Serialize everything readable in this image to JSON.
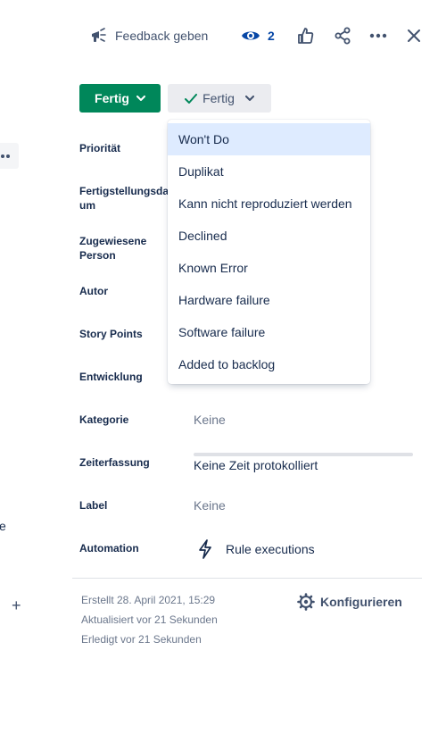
{
  "header": {
    "feedback_label": "Feedback geben",
    "watch_count": "2"
  },
  "status": {
    "current_label": "Fertig",
    "resolution_label": "Fertig",
    "status_color": "#00875a"
  },
  "resolution_menu": {
    "options": [
      "Won't Do",
      "Duplikat",
      "Kann nicht reproduziert werden",
      "Declined",
      "Known Error",
      "Hardware failure",
      "Software failure",
      "Added to backlog"
    ],
    "highlighted": "Won't Do"
  },
  "fields": {
    "priority_label": "Priorität",
    "due_date_label": "Fertigstellungsdatum",
    "assignee_label": "Zugewiesene Person",
    "reporter_label": "Autor",
    "story_points_label": "Story Points",
    "development_label": "Entwicklung",
    "category_label": "Kategorie",
    "category_value": "Keine",
    "time_tracking_label": "Zeiterfassung",
    "time_tracking_value": "Keine Zeit protokolliert",
    "label_label": "Label",
    "label_value": "Keine",
    "automation_label": "Automation",
    "automation_value": "Rule executions"
  },
  "footer": {
    "created": "Erstellt 28. April 2021, 15:29",
    "updated": "Aktualisiert vor 21 Sekunden",
    "resolved": "Erledigt vor 21 Sekunden",
    "configure_label": "Konfigurieren"
  },
  "left_panel": {
    "edge_text": "e",
    "plus_symbol": "+"
  }
}
